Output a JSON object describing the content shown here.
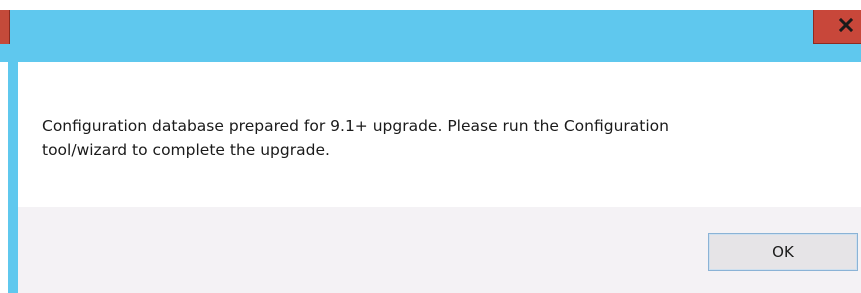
{
  "dialog": {
    "message_line1": "Configuration database prepared for 9.1+ upgrade. Please run the Configuration",
    "message_line2": "tool/wizard to complete the upgrade.",
    "ok_label": "OK"
  },
  "titlebar": {
    "close_icon": "close-icon"
  },
  "colors": {
    "titlebar": "#5fc8ee",
    "close_button": "#c8473a",
    "footer": "#f4f2f5",
    "button_border": "#8bb3d6"
  }
}
